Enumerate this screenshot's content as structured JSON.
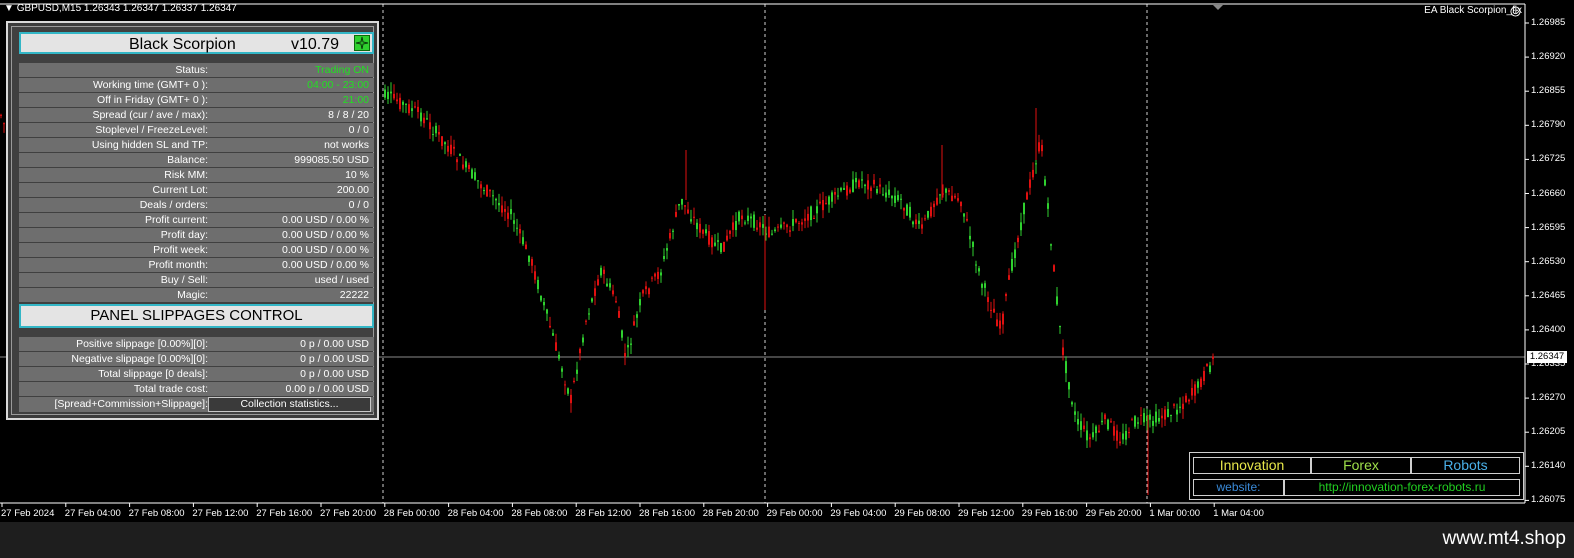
{
  "chart": {
    "symbol_info": "GBPUSD,M15  1.26343 1.26347 1.26337 1.26347",
    "ea_label": "EA Black Scorpion_fix",
    "current_price": "1.26347",
    "price_labels": [
      "1.26985",
      "1.26920",
      "1.26855",
      "1.26790",
      "1.26725",
      "1.26660",
      "1.26595",
      "1.26530",
      "1.26465",
      "1.26400",
      "1.26335",
      "1.26270",
      "1.26205",
      "1.26140",
      "1.26075"
    ],
    "time_labels": [
      "27 Feb 2024",
      "27 Feb 04:00",
      "27 Feb 08:00",
      "27 Feb 12:00",
      "27 Feb 16:00",
      "27 Feb 20:00",
      "28 Feb 00:00",
      "28 Feb 04:00",
      "28 Feb 08:00",
      "28 Feb 12:00",
      "28 Feb 16:00",
      "28 Feb 20:00",
      "29 Feb 00:00",
      "29 Feb 04:00",
      "29 Feb 08:00",
      "29 Feb 12:00",
      "29 Feb 16:00",
      "29 Feb 20:00",
      "1 Mar 00:00",
      "1 Mar 04:00"
    ],
    "bull_color": "#2fd12f",
    "bear_color": "#e01010"
  },
  "panel": {
    "title": "Black Scorpion",
    "version": "v10.79",
    "rows": [
      {
        "label": "Status:",
        "value": "Trading ON",
        "green": true
      },
      {
        "label": "Working time (GMT+ 0 ):",
        "value": "04:00 - 23:00",
        "green": true
      },
      {
        "label": "Off in Friday (GMT+ 0 ):",
        "value": "21:00",
        "green": true
      },
      {
        "label": "Spread (cur / ave / max):",
        "value": "8 / 8 / 20",
        "green": false
      },
      {
        "label": "Stoplevel   /   FreezeLevel:",
        "value": "0    /    0",
        "green": false
      },
      {
        "label": "Using hidden SL and TP:",
        "value": "not works",
        "green": false
      },
      {
        "label": "Balance:",
        "value": "999085.50  USD",
        "green": false
      },
      {
        "label": "Risk MM:",
        "value": "10 %",
        "green": false
      },
      {
        "label": "Current Lot:",
        "value": "200.00",
        "green": false
      },
      {
        "label": "Deals / orders:",
        "value": "0  /  0",
        "green": false
      },
      {
        "label": "Profit current:",
        "value": "0.00 USD / 0.00 %",
        "green": false
      },
      {
        "label": "Profit day:",
        "value": "0.00 USD / 0.00 %",
        "green": false
      },
      {
        "label": "Profit week:",
        "value": "0.00 USD / 0.00 %",
        "green": false
      },
      {
        "label": "Profit month:",
        "value": "0.00 USD / 0.00 %",
        "green": false
      },
      {
        "label": "Buy / Sell:",
        "value": "used  /  used",
        "green": false
      },
      {
        "label": "Magic:",
        "value": "22222",
        "green": false
      }
    ],
    "slippage_title": "PANEL SLIPPAGES CONTROL",
    "slippage_rows": [
      {
        "label": "Positive slippage [0.00%][0]:",
        "value": "0 p / 0.00 USD"
      },
      {
        "label": "Negative slippage [0.00%][0]:",
        "value": "0 p / 0.00 USD"
      },
      {
        "label": "Total slippage [0 deals]:",
        "value": "0 p / 0.00 USD"
      },
      {
        "label": "Total trade cost:",
        "value": "0.00 p / 0.00 USD"
      }
    ],
    "stats_label": "[Spread+Commission+Slippage]:",
    "stats_button": "Collection statistics..."
  },
  "branding": {
    "innovation": "Innovation",
    "forex": "Forex",
    "robots": "Robots",
    "website_label": "website:",
    "website_url": "http://innovation-forex-robots.ru",
    "innovation_color": "#e8e84a",
    "forex_color": "#9fe04a",
    "robots_color": "#4ab0e8",
    "website_label_color": "#3a8ad8",
    "website_url_color": "#21d121"
  },
  "footer": {
    "site": "www.mt4.shop"
  }
}
